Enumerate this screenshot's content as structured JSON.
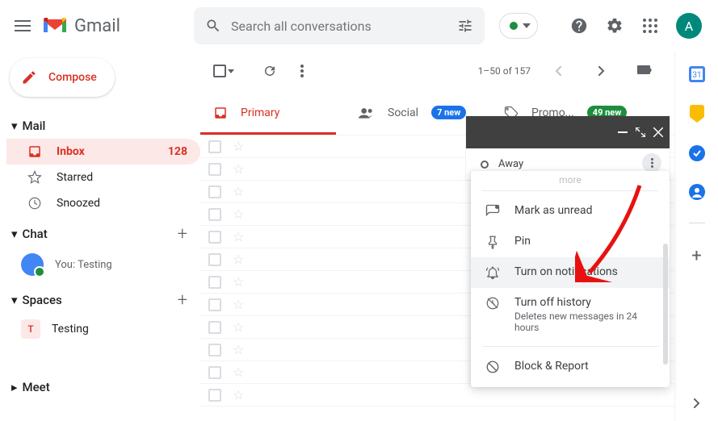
{
  "header": {
    "app_name": "Gmail",
    "search_placeholder": "Search all conversations",
    "avatar_letter": "A"
  },
  "compose_label": "Compose",
  "sidebar": {
    "mail_label": "Mail",
    "chat_label": "Chat",
    "spaces_label": "Spaces",
    "meet_label": "Meet",
    "items": [
      {
        "label": "Inbox",
        "count": "128"
      },
      {
        "label": "Starred"
      },
      {
        "label": "Snoozed"
      }
    ],
    "chat_status": "You: Testing",
    "space_initial": "T",
    "space_name": "Testing"
  },
  "toolbar": {
    "pagination": "1–50 of 157"
  },
  "tabs": [
    {
      "label": "Primary"
    },
    {
      "label": "Social",
      "badge": "7 new"
    },
    {
      "label": "Promo...",
      "badge": "49 new"
    }
  ],
  "popup": {
    "away_label": "Away",
    "more_cutoff": "more"
  },
  "menu": {
    "mark_unread": "Mark as unread",
    "pin": "Pin",
    "notifications": "Turn on notifications",
    "history": "Turn off history",
    "history_sub": "Deletes new messages in 24 hours",
    "block": "Block & Report"
  }
}
